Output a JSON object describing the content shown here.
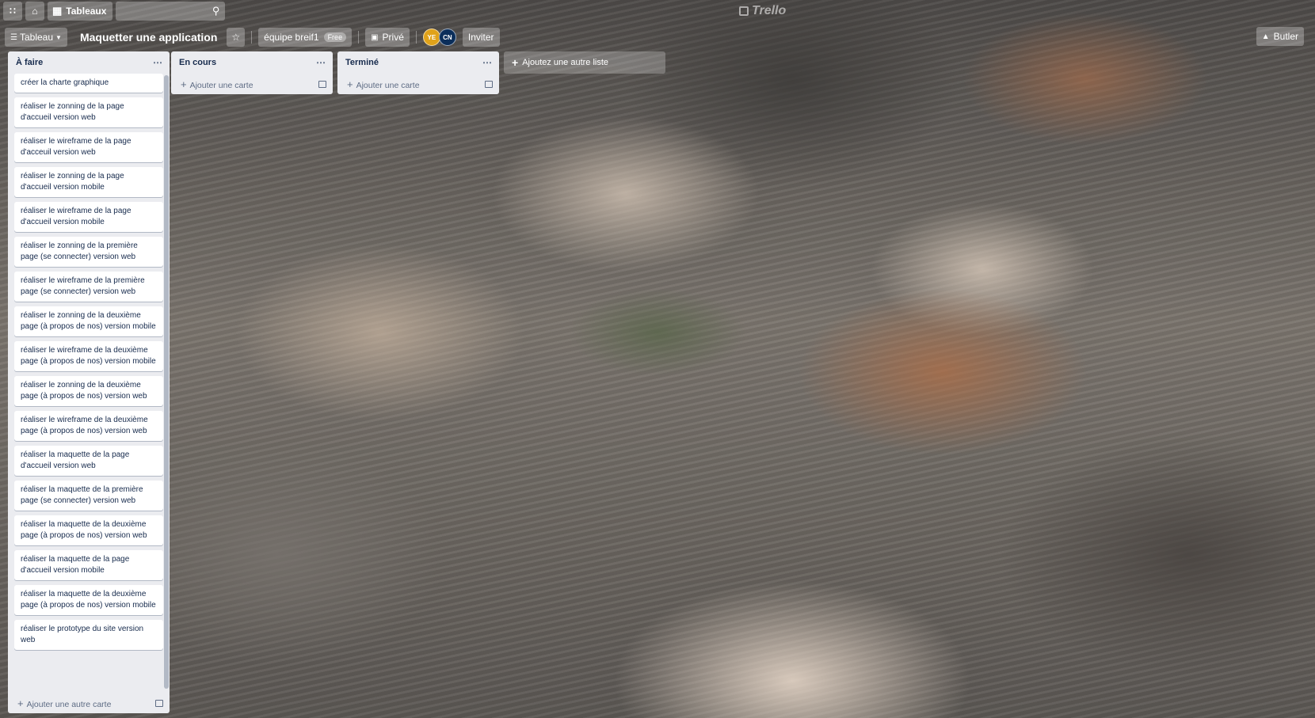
{
  "topbar": {
    "apps_icon": "grid-icon",
    "home_icon": "home-icon",
    "boards_label": "Tableaux",
    "search_icon": "search-icon",
    "logo": "Trello"
  },
  "board": {
    "view_label": "Tableau",
    "title": "Maquetter une application",
    "star_icon": "star-icon",
    "team_label": "équipe breif1",
    "team_badge": "Free",
    "visibility_label": "Privé",
    "members": [
      "YE",
      "CN"
    ],
    "invite_label": "Inviter",
    "butler_label": "Butler"
  },
  "lists": [
    {
      "title": "À faire",
      "cards": [
        "créer la charte graphique",
        "réaliser le zonning de la page d'accueil version web",
        "réaliser le wireframe de la page d'acceuil version web",
        "réaliser le zonning de la page d'accueil version mobile",
        "réaliser le wireframe de la page d'accueil version mobile",
        "réaliser le zonning de la première page (se connecter) version web",
        "réaliser le wireframe de la première page (se connecter) version web",
        "réaliser le zonning de la deuxième page (à propos de nos) version mobile",
        "réaliser le wireframe de la deuxième page (à propos de nos) version mobile",
        "réaliser le zonning de la deuxième page (à propos de nos) version web",
        "réaliser le wireframe de la deuxième page (à propos de nos) version web",
        "réaliser la maquette de la page d'accueil version web",
        "réaliser la maquette de la première page (se connecter) version web",
        "réaliser la maquette de la deuxième page (à propos de nos) version web",
        "réaliser la maquette de la page d'accueil version mobile",
        "réaliser la maquette de la deuxième page (à propos de nos) version mobile",
        "réaliser le prototype du site version web"
      ],
      "add_label": "Ajouter une autre carte"
    },
    {
      "title": "En cours",
      "cards": [],
      "add_label": "Ajouter une carte"
    },
    {
      "title": "Terminé",
      "cards": [],
      "add_label": "Ajouter une carte"
    }
  ],
  "add_list_label": "Ajoutez une autre liste"
}
